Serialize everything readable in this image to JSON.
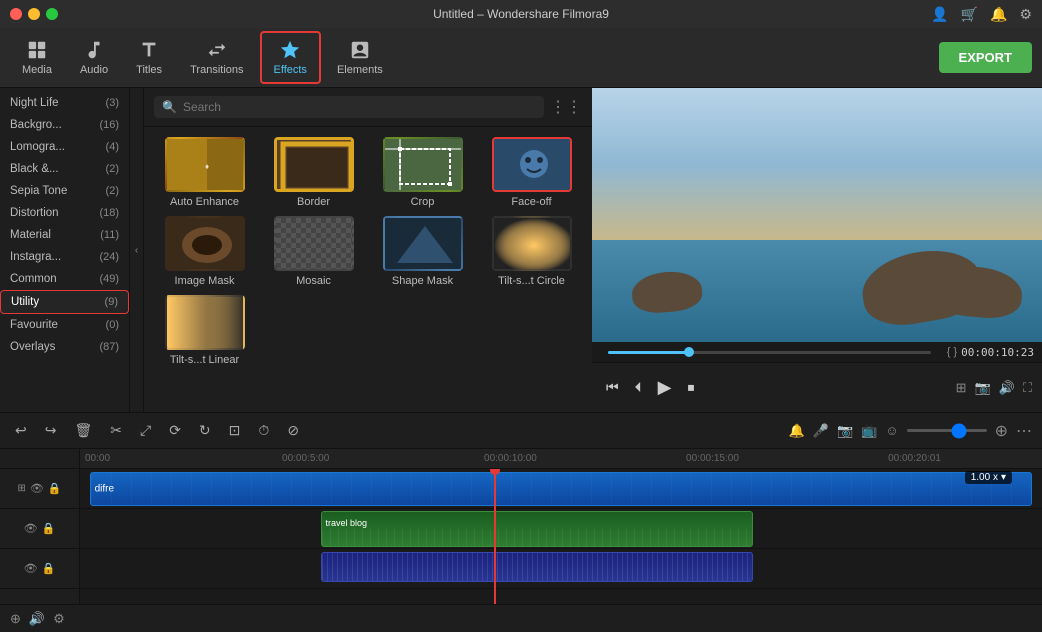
{
  "app": {
    "title": "Untitled – Wondershare Filmora9"
  },
  "titlebar": {
    "dots": [
      "red",
      "yellow",
      "green"
    ]
  },
  "toolbar": {
    "items": [
      {
        "id": "media",
        "label": "Media",
        "icon": "▣"
      },
      {
        "id": "audio",
        "label": "Audio",
        "icon": "♪"
      },
      {
        "id": "titles",
        "label": "Titles",
        "icon": "T"
      },
      {
        "id": "transitions",
        "label": "Transitions",
        "icon": "⇄"
      },
      {
        "id": "effects",
        "label": "Effects",
        "icon": "✦"
      },
      {
        "id": "elements",
        "label": "Elements",
        "icon": "◈"
      }
    ],
    "active": "effects",
    "export_label": "EXPORT"
  },
  "sidebar": {
    "items": [
      {
        "label": "Night Life",
        "count": "(3)"
      },
      {
        "label": "Backgro...",
        "count": "(16)"
      },
      {
        "label": "Lomogra...",
        "count": "(4)"
      },
      {
        "label": "Black &...",
        "count": "(2)"
      },
      {
        "label": "Sepia Tone",
        "count": "(2)"
      },
      {
        "label": "Distortion",
        "count": "(18)"
      },
      {
        "label": "Material",
        "count": "(11)"
      },
      {
        "label": "Instagra...",
        "count": "(24)"
      },
      {
        "label": "Common",
        "count": "(49)"
      },
      {
        "label": "Utility",
        "count": "(9)",
        "active": true
      },
      {
        "label": "Favourite",
        "count": "(0)"
      },
      {
        "label": "Overlays",
        "count": "(87)"
      }
    ]
  },
  "search": {
    "placeholder": "Search"
  },
  "effects": {
    "items": [
      {
        "id": "auto-enhance",
        "label": "Auto Enhance",
        "selected": false,
        "thumb": "enhance"
      },
      {
        "id": "border",
        "label": "Border",
        "selected": false,
        "thumb": "border"
      },
      {
        "id": "crop",
        "label": "Crop",
        "selected": false,
        "thumb": "crop"
      },
      {
        "id": "face-off",
        "label": "Face-off",
        "selected": true,
        "thumb": "faceoff"
      },
      {
        "id": "image-mask",
        "label": "Image Mask",
        "selected": false,
        "thumb": "imagemask"
      },
      {
        "id": "mosaic",
        "label": "Mosaic",
        "selected": false,
        "thumb": "mosaic"
      },
      {
        "id": "shape-mask",
        "label": "Shape Mask",
        "selected": false,
        "thumb": "shapemask"
      },
      {
        "id": "tilt-circle",
        "label": "Tilt-s...t Circle",
        "selected": false,
        "thumb": "tiltcircle"
      },
      {
        "id": "tilt-linear",
        "label": "Tilt-s...t Linear",
        "selected": false,
        "thumb": "tiltlinear"
      }
    ]
  },
  "preview": {
    "timecode": "00:00:10:23",
    "progress_pct": 25,
    "controls": [
      "rewind",
      "play-back",
      "play",
      "stop"
    ]
  },
  "timeline": {
    "timecodes": [
      "00:00",
      "00:00:5:00",
      "00:00:10:00",
      "00:00:15:00",
      "00:00:20:01"
    ],
    "speed_badge": "1.00 x",
    "track_label": "difre",
    "track_label2": "travel blog",
    "tools": [
      "undo",
      "redo",
      "delete",
      "cut",
      "transform",
      "group",
      "rotate",
      "crop",
      "speed",
      "split"
    ],
    "zoom_value": ""
  }
}
